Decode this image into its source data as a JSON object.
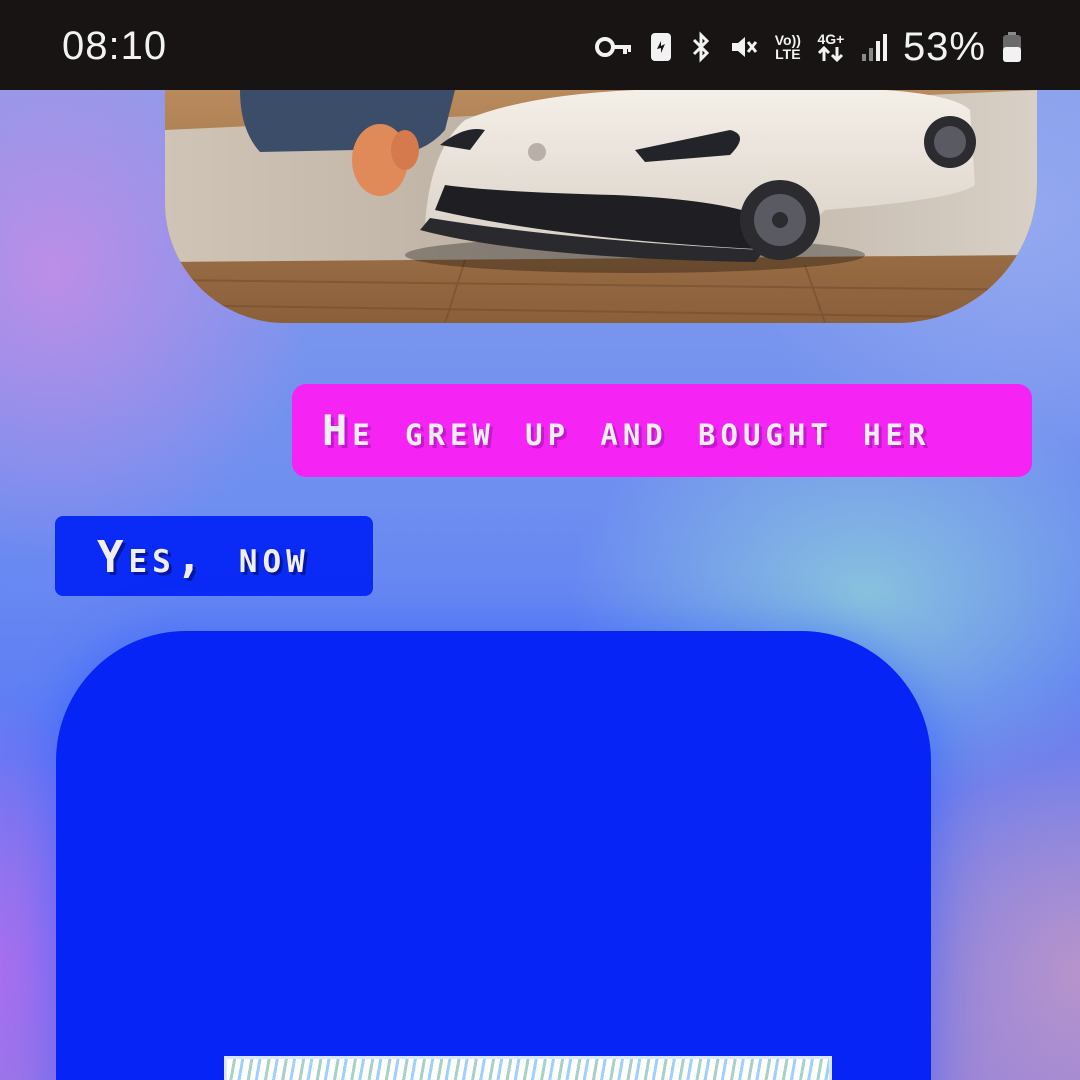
{
  "status_bar": {
    "time": "08:10",
    "icons": [
      "key-icon",
      "screen-record-icon",
      "bluetooth-icon",
      "mute-icon",
      "volte-icon",
      "4g-data-icon",
      "signal-icon",
      "battery-icon"
    ],
    "volte_line1": "Vo))",
    "volte_line2": "LTE",
    "network_label": "4G+",
    "battery_percent": "53%"
  },
  "chat": {
    "messages": [
      {
        "direction": "sent",
        "text": "He grew up and bought her"
      },
      {
        "direction": "received",
        "text": "Yes, now"
      }
    ]
  },
  "colors": {
    "status_bar_bg": "#171413",
    "sent_bubble": "#f524f5",
    "received_bubble": "#0a2bf5",
    "media_card": "#0524f5"
  }
}
